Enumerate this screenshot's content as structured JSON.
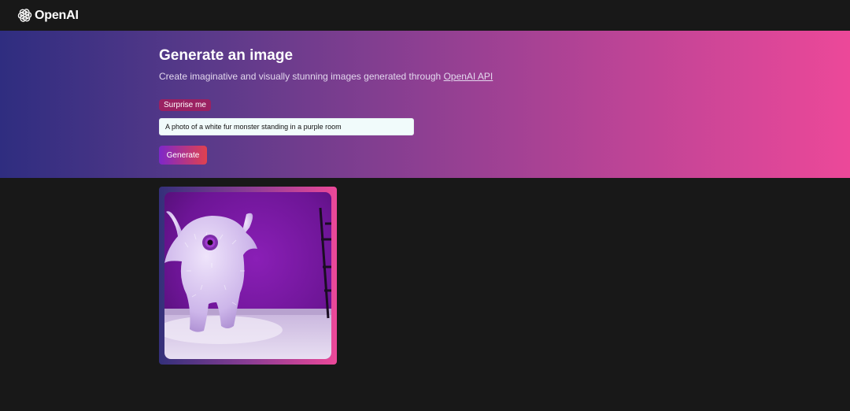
{
  "header": {
    "brand_name": "OpenAI",
    "logo_icon": "openai-logo-icon"
  },
  "hero": {
    "title": "Generate an image",
    "subtitle_prefix": "Create imaginative and visually stunning images generated through ",
    "subtitle_link": "OpenAI API",
    "surprise_label": "Surprise me",
    "prompt_value": "A photo of a white fur monster standing in a purple room",
    "generate_label": "Generate"
  },
  "result": {
    "image_subject": "white fur monster in purple room"
  },
  "colors": {
    "background": "#181818",
    "gradient_start": "#2f2d80",
    "gradient_end": "#ec4899",
    "surprise_button": "#9a2161",
    "generate_start": "#7e27c9",
    "generate_end": "#e0414f",
    "input_bg": "#f1fbfb"
  }
}
